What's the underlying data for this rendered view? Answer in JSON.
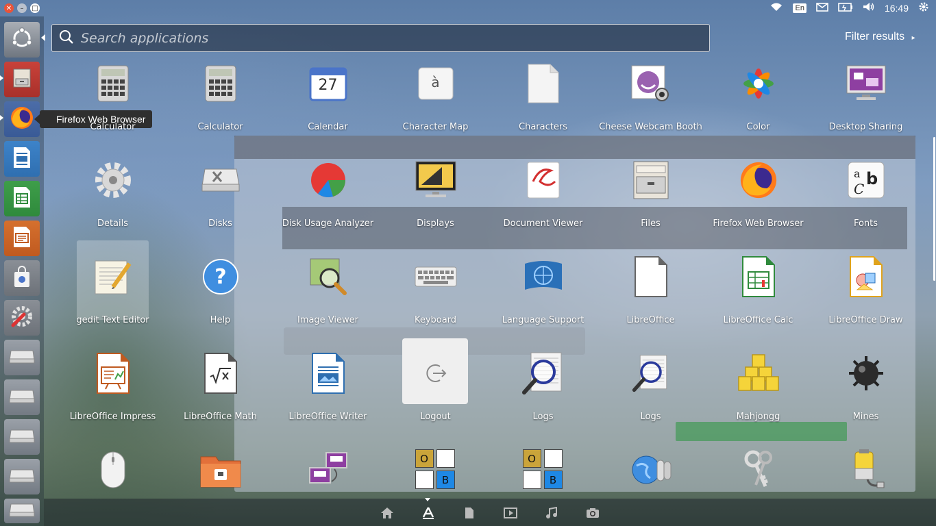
{
  "top_panel": {
    "lang": "En",
    "time": "16:49"
  },
  "tooltip": "Firefox Web Browser",
  "search": {
    "placeholder": "Search applications",
    "value": ""
  },
  "filter_label": "Filter results",
  "apps": [
    {
      "label": "Calculator",
      "icon": "calculator-icon"
    },
    {
      "label": "Calculator",
      "icon": "calculator-icon"
    },
    {
      "label": "Calendar",
      "icon": "calendar-icon",
      "day": "27"
    },
    {
      "label": "Character Map",
      "icon": "character-map-icon",
      "glyph": "à"
    },
    {
      "label": "Characters",
      "icon": "characters-icon"
    },
    {
      "label": "Cheese Webcam Booth",
      "icon": "cheese-icon"
    },
    {
      "label": "Color",
      "icon": "color-icon"
    },
    {
      "label": "Desktop Sharing",
      "icon": "desktop-sharing-icon"
    },
    {
      "label": "Details",
      "icon": "details-gear-icon"
    },
    {
      "label": "Disks",
      "icon": "disks-icon"
    },
    {
      "label": "Disk Usage Analyzer",
      "icon": "disk-usage-icon"
    },
    {
      "label": "Displays",
      "icon": "displays-icon"
    },
    {
      "label": "Document Viewer",
      "icon": "document-viewer-icon"
    },
    {
      "label": "Files",
      "icon": "files-icon"
    },
    {
      "label": "Firefox Web Browser",
      "icon": "firefox-icon"
    },
    {
      "label": "Fonts",
      "icon": "fonts-icon"
    },
    {
      "label": "gedit Text Editor",
      "icon": "gedit-icon"
    },
    {
      "label": "Help",
      "icon": "help-icon"
    },
    {
      "label": "Image Viewer",
      "icon": "image-viewer-icon"
    },
    {
      "label": "Keyboard",
      "icon": "keyboard-icon"
    },
    {
      "label": "Language Support",
      "icon": "language-support-icon"
    },
    {
      "label": "LibreOffice",
      "icon": "libreoffice-icon"
    },
    {
      "label": "LibreOffice Calc",
      "icon": "libreoffice-calc-icon"
    },
    {
      "label": "LibreOffice Draw",
      "icon": "libreoffice-draw-icon"
    },
    {
      "label": "LibreOffice Impress",
      "icon": "libreoffice-impress-icon"
    },
    {
      "label": "LibreOffice Math",
      "icon": "libreoffice-math-icon"
    },
    {
      "label": "LibreOffice Writer",
      "icon": "libreoffice-writer-icon"
    },
    {
      "label": "Logout",
      "icon": "logout-icon"
    },
    {
      "label": "Logs",
      "icon": "logs-icon"
    },
    {
      "label": "Logs",
      "icon": "logs-icon"
    },
    {
      "label": "Mahjongg",
      "icon": "mahjongg-icon"
    },
    {
      "label": "Mines",
      "icon": "mines-icon"
    },
    {
      "label": "",
      "icon": "mouse-icon"
    },
    {
      "label": "",
      "icon": "folder-share-icon"
    },
    {
      "label": "",
      "icon": "network-icon"
    },
    {
      "label": "",
      "icon": "tiles-icon",
      "tiles": [
        "O",
        "B"
      ]
    },
    {
      "label": "",
      "icon": "tiles-icon",
      "tiles": [
        "O",
        "B"
      ]
    },
    {
      "label": "",
      "icon": "network-globe-icon"
    },
    {
      "label": "",
      "icon": "keys-icon"
    },
    {
      "label": "",
      "icon": "power-icon"
    }
  ]
}
